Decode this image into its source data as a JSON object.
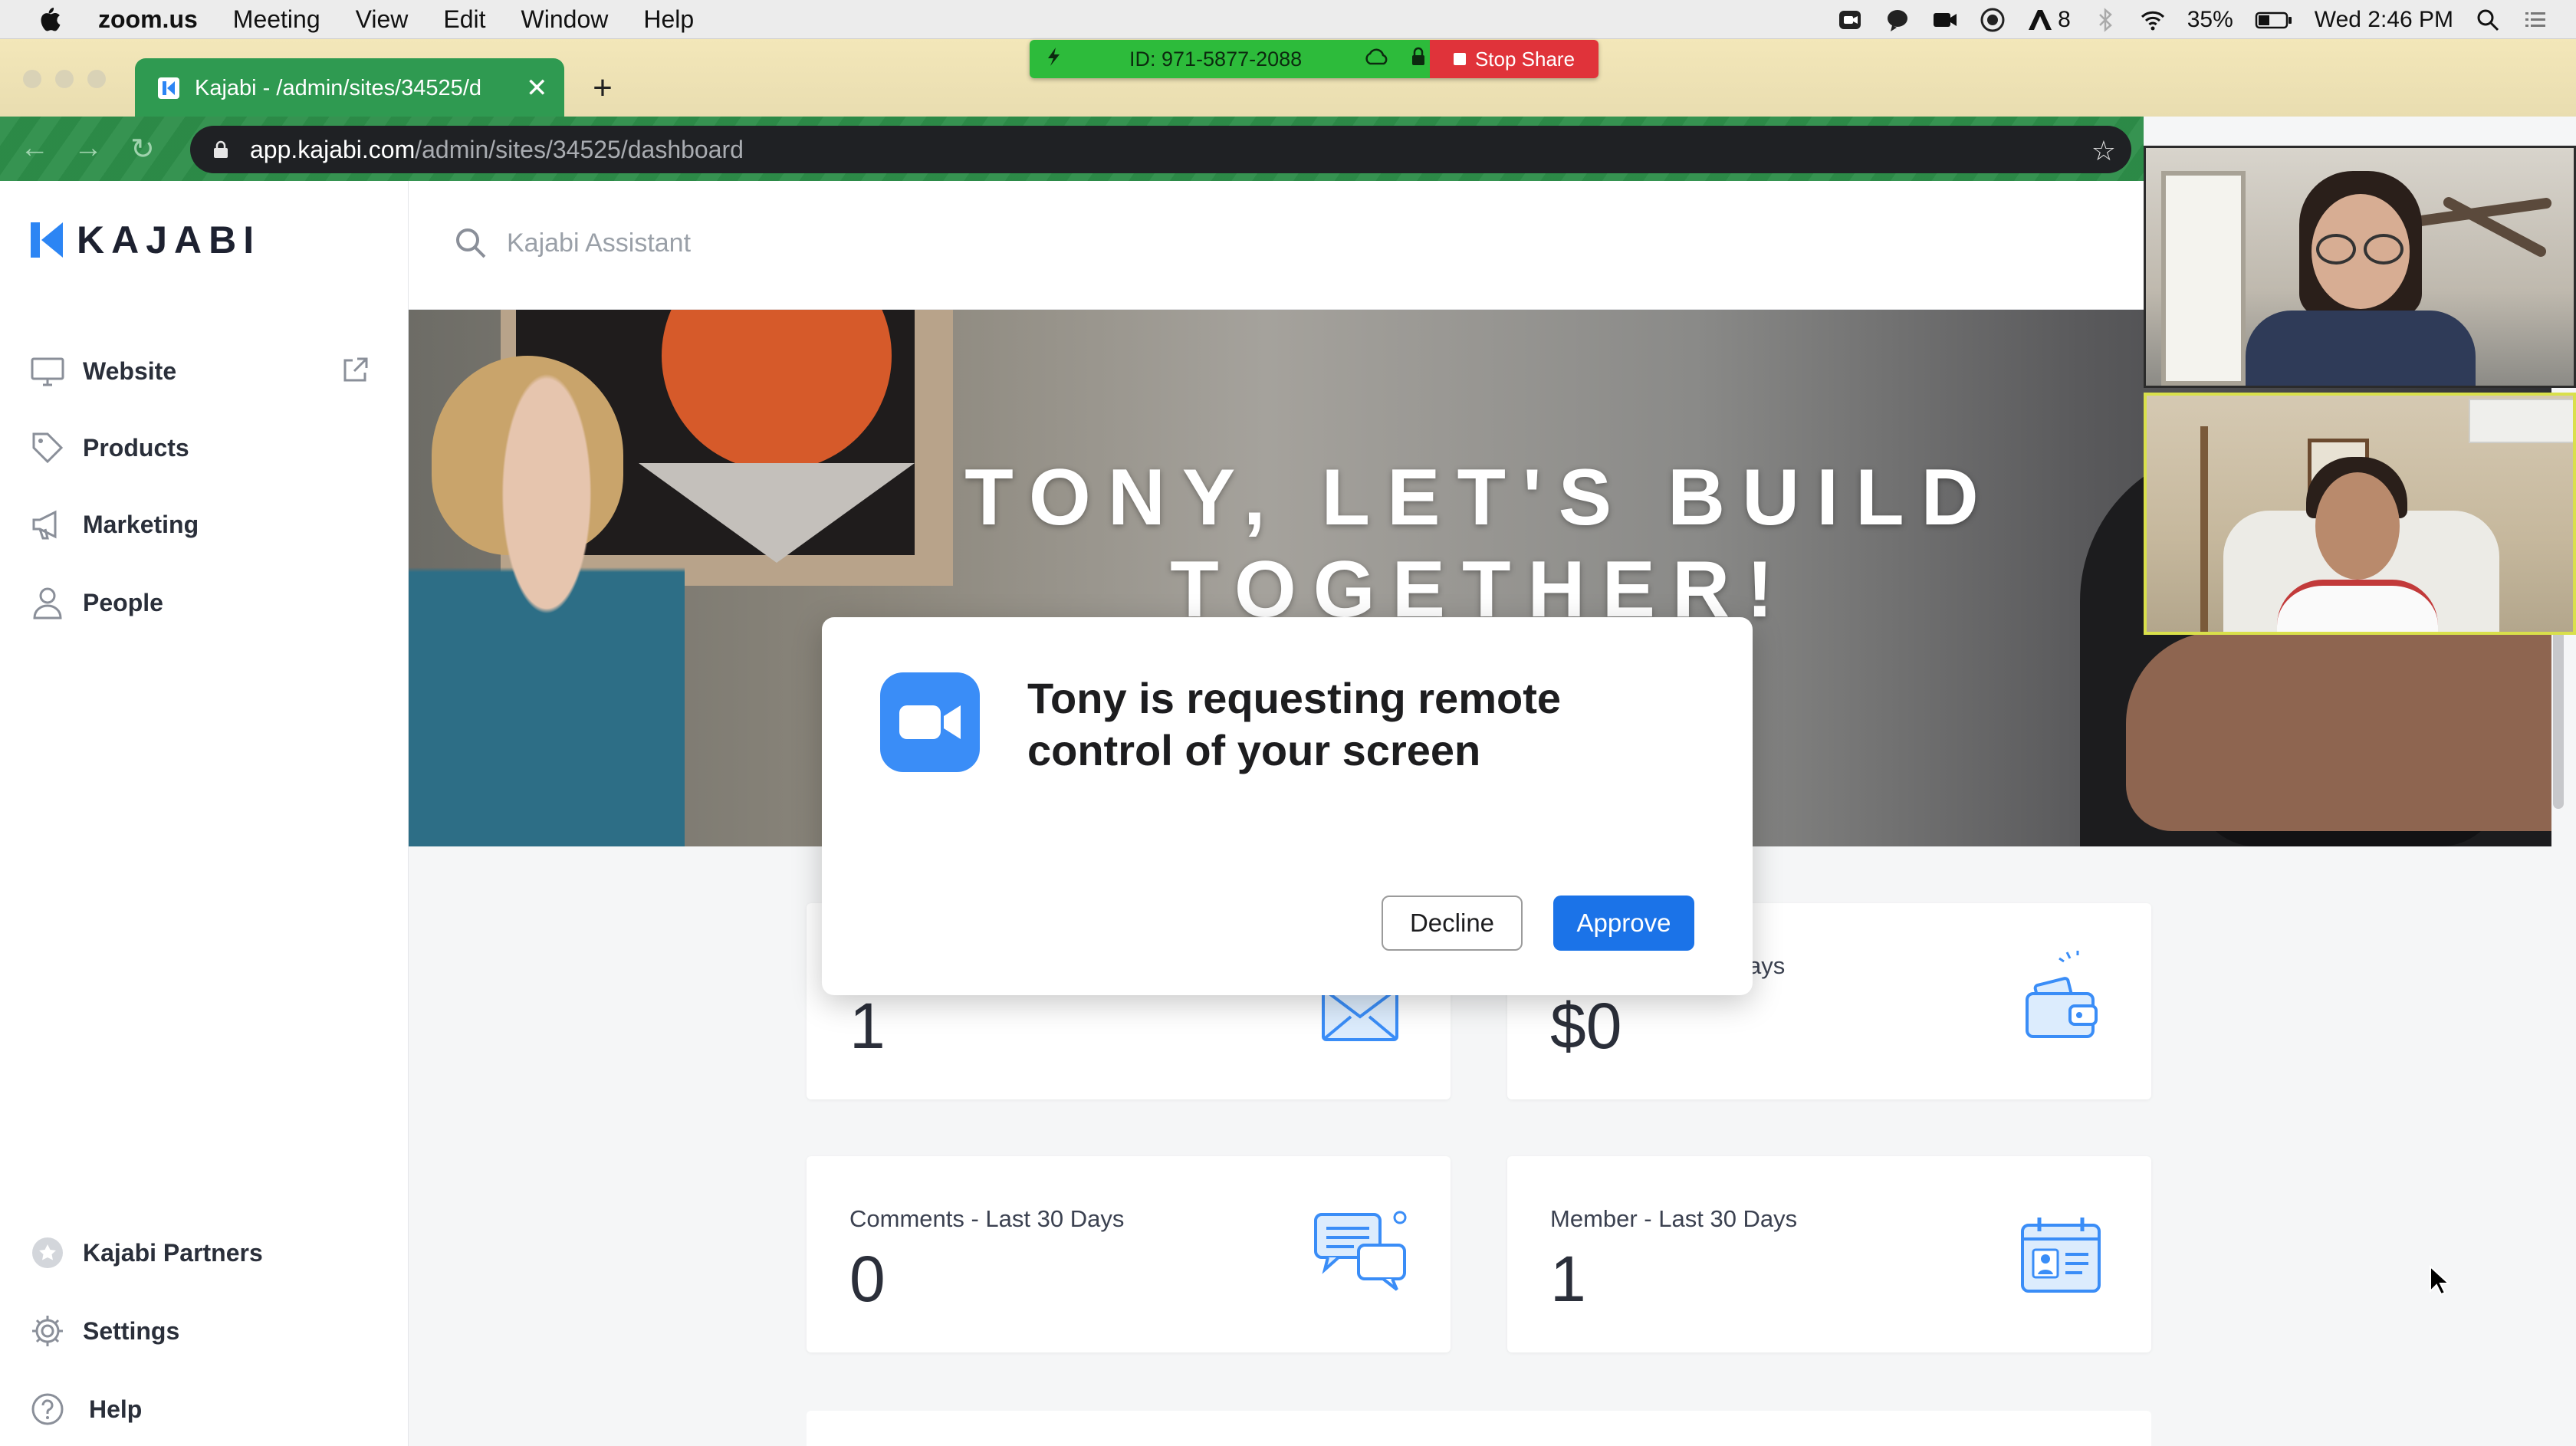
{
  "menubar": {
    "app": "zoom.us",
    "items": [
      "Meeting",
      "View",
      "Edit",
      "Window",
      "Help"
    ],
    "status_badge": "8",
    "battery": "35%",
    "clock": "Wed 2:46 PM"
  },
  "share": {
    "meeting_id": "ID: 971-5877-2088",
    "stop_label": "Stop Share"
  },
  "browser": {
    "tab_title": "Kajabi - /admin/sites/34525/d",
    "url_host": "app.kajabi.com",
    "url_path": "/admin/sites/34525/dashboard"
  },
  "sidebar": {
    "brand": "KAJABI",
    "items": [
      {
        "label": "Website",
        "icon": "monitor-icon"
      },
      {
        "label": "Products",
        "icon": "tag-icon"
      },
      {
        "label": "Marketing",
        "icon": "megaphone-icon"
      },
      {
        "label": "People",
        "icon": "person-icon"
      }
    ],
    "bottom": [
      {
        "label": "Kajabi Partners",
        "icon": "star-badge-icon"
      },
      {
        "label": "Settings",
        "icon": "gear-icon"
      },
      {
        "label": "Help",
        "icon": "help-circle-icon"
      }
    ]
  },
  "search": {
    "placeholder": "Kajabi Assistant"
  },
  "hero": {
    "line1": "TONY, LET'S BUILD",
    "line2": "TOGETHER!"
  },
  "cards": [
    {
      "label": "",
      "value": "1",
      "icon": "envelope-icon"
    },
    {
      "label": "ays",
      "value": "$0",
      "icon": "wallet-icon"
    },
    {
      "label": "Comments - Last 30 Days",
      "value": "0",
      "icon": "chat-bubbles-icon"
    },
    {
      "label": "Member - Last 30 Days",
      "value": "1",
      "icon": "member-card-icon"
    }
  ],
  "modal": {
    "message": "Tony is requesting remote control of your screen",
    "decline": "Decline",
    "approve": "Approve"
  },
  "colors": {
    "zoom_blue": "#3a8df7",
    "approve_blue": "#1b73e8",
    "kajabi_blue": "#2c85f4",
    "tab_green": "#2f9a51"
  }
}
